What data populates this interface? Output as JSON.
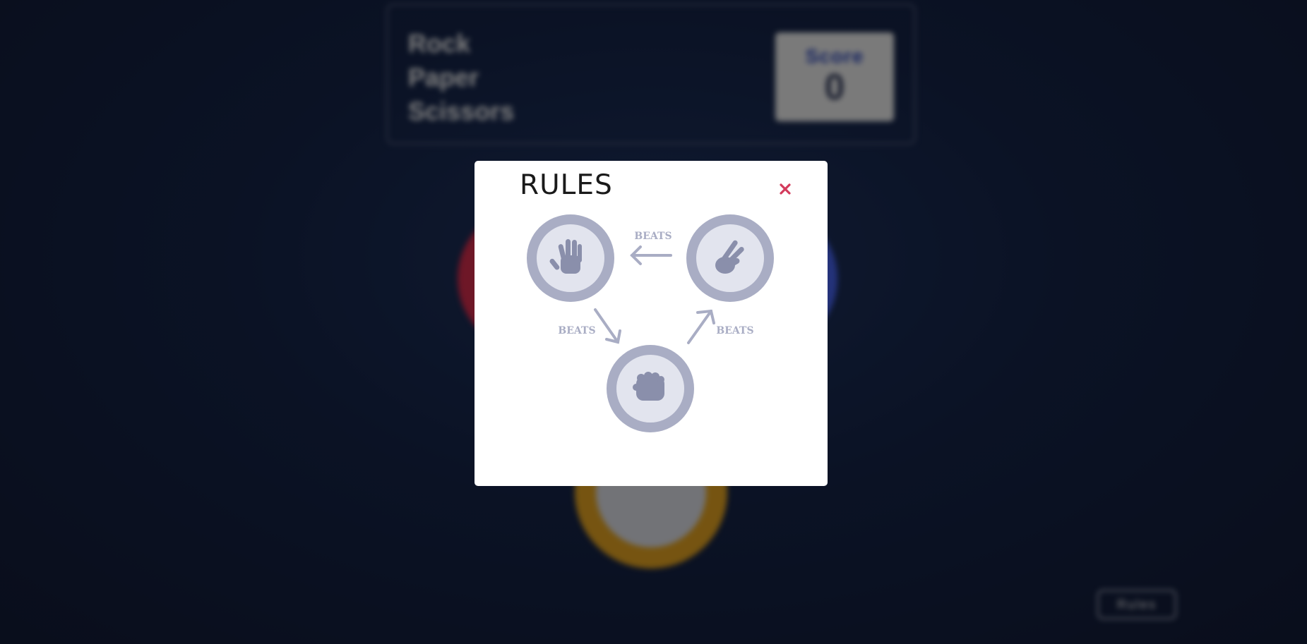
{
  "header": {
    "title_lines": [
      "Rock",
      "Paper",
      "Scissors"
    ],
    "score_label": "Score",
    "score_value": "0"
  },
  "background_buttons": {
    "rules_label": "Rules"
  },
  "modal": {
    "title": "RULES",
    "close_icon": "close-icon",
    "beats_labels": {
      "scissors_to_paper": "BEATS",
      "paper_to_rock": "BEATS",
      "rock_to_scissors": "BEATS"
    },
    "icons": {
      "paper": "paper-hand-icon",
      "scissors": "scissors-hand-icon",
      "rock": "rock-fist-icon"
    }
  },
  "colors": {
    "close": "#d33a5b",
    "diagram_gray": "#a9adc4",
    "diagram_inner": "#e2e4ee",
    "hand": "#8a8fab",
    "paper_chip": "#dc2e4e",
    "scissors_chip": "#eca922",
    "rock_chip": "#4865f4"
  }
}
